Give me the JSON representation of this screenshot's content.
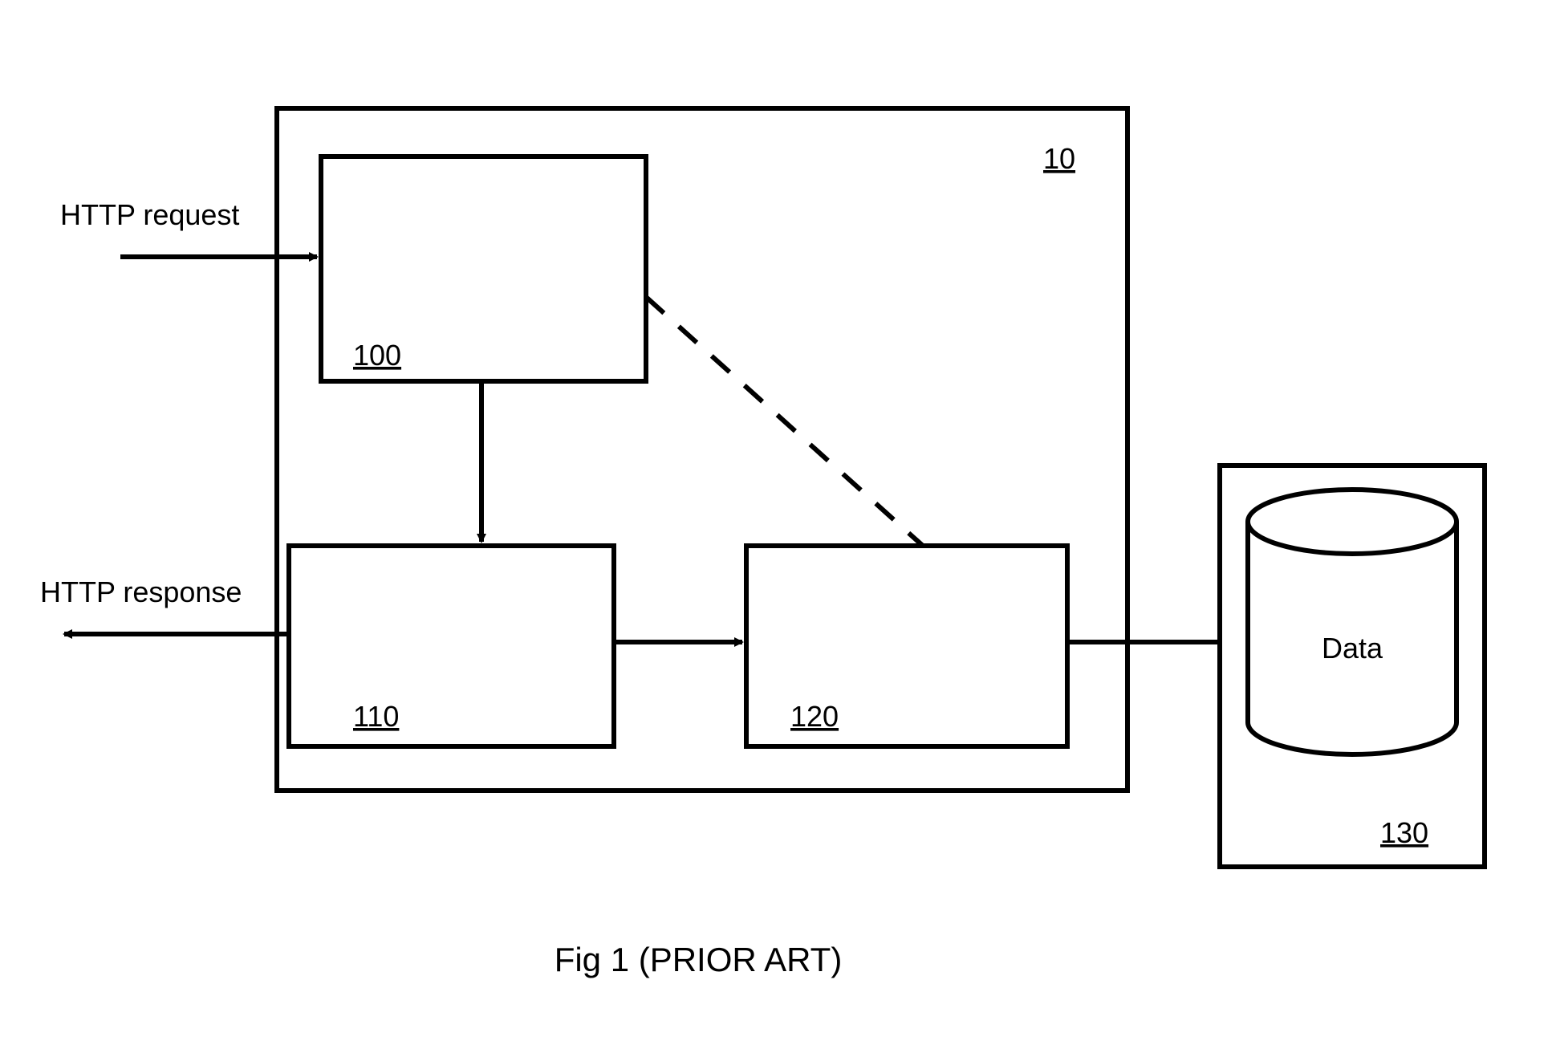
{
  "labels": {
    "request": "HTTP request",
    "response": "HTTP response",
    "data": "Data"
  },
  "ids": {
    "container": "10",
    "box100": "100",
    "box110": "110",
    "box120": "120",
    "box130": "130"
  },
  "caption": "Fig 1 (PRIOR ART)"
}
